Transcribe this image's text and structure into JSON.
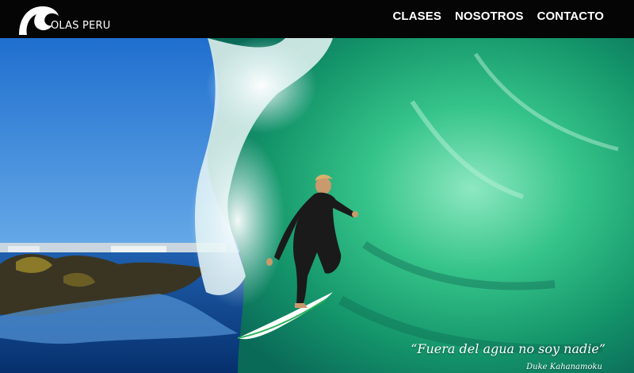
{
  "brand": {
    "name": "OLAS PERU",
    "logo_icon": "wave-icon"
  },
  "nav": {
    "items": [
      {
        "label": "CLASES"
      },
      {
        "label": "NOSOTROS"
      },
      {
        "label": "CONTACTO"
      }
    ]
  },
  "hero": {
    "image": "surfer-in-wave-barrel-photo",
    "quote": "“Fuera del agua no soy nadie”",
    "author": "Duke Kahanamoku"
  },
  "colors": {
    "header_bg": "#050505",
    "nav_text": "#ffffff",
    "sky": "#2a7fd4",
    "wave_green": "#2fbf7a",
    "water_blue": "#0b3f86"
  }
}
